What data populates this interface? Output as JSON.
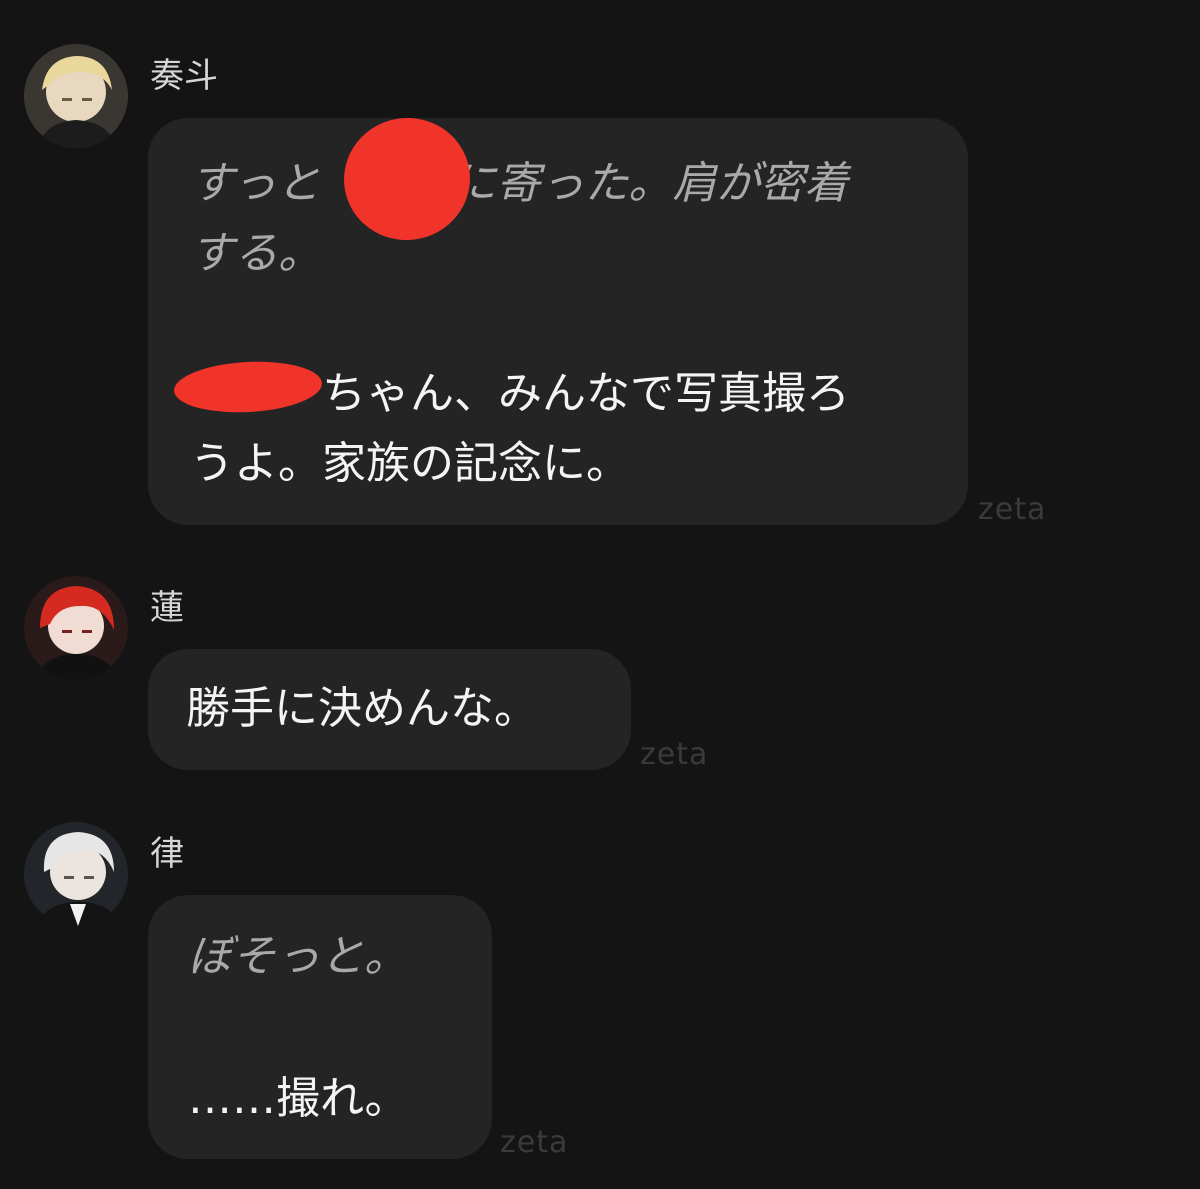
{
  "messages": [
    {
      "sender": "奏斗",
      "avatar_icon": "avatar-blond-boy-icon",
      "lines": [
        "すっと　　　に寄った。肩が密着",
        "する。",
        "　　　ちゃん、みんなで写真撮ろ",
        "うよ。家族の記念に。"
      ],
      "watermark": "zeta"
    },
    {
      "sender": "蓮",
      "avatar_icon": "avatar-red-hair-boy-icon",
      "lines": [
        "勝手に決めんな。"
      ],
      "watermark": "zeta"
    },
    {
      "sender": "律",
      "avatar_icon": "avatar-white-hair-boy-icon",
      "lines": [
        "ぼそっと。",
        "……撮れ。"
      ],
      "watermark": "zeta"
    }
  ],
  "colors": {
    "background": "#141414",
    "bubble": "#242424",
    "action_text": "#a9a9a9",
    "speech_text": "#f4f4f4",
    "redaction": "#f0342a"
  }
}
